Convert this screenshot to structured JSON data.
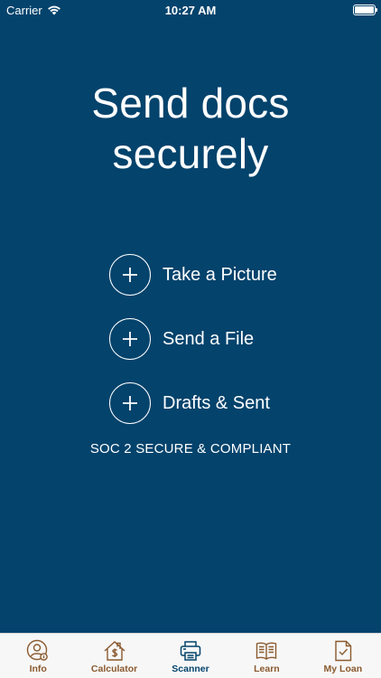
{
  "status_bar": {
    "carrier": "Carrier",
    "time": "10:27 AM",
    "battery_level": 1.0
  },
  "headline": {
    "line1": "Send docs",
    "line2": "securely"
  },
  "actions": [
    {
      "label": "Take a Picture",
      "icon": "plus-circle-icon"
    },
    {
      "label": "Send a File",
      "icon": "plus-circle-icon"
    },
    {
      "label": "Drafts & Sent",
      "icon": "plus-circle-icon"
    }
  ],
  "compliance_text": "SOC 2 SECURE & COMPLIANT",
  "tab_bar": {
    "tabs": [
      {
        "label": "Info",
        "icon": "user-info-icon",
        "active": false
      },
      {
        "label": "Calculator",
        "icon": "house-dollar-icon",
        "active": false
      },
      {
        "label": "Scanner",
        "icon": "printer-icon",
        "active": true
      },
      {
        "label": "Learn",
        "icon": "book-icon",
        "active": false
      },
      {
        "label": "My Loan",
        "icon": "document-check-icon",
        "active": false
      }
    ]
  },
  "colors": {
    "background": "#03436c",
    "tab_inactive": "#8a5a2e",
    "tab_active": "#03436c",
    "tab_bar_bg": "#f7f7f7"
  }
}
